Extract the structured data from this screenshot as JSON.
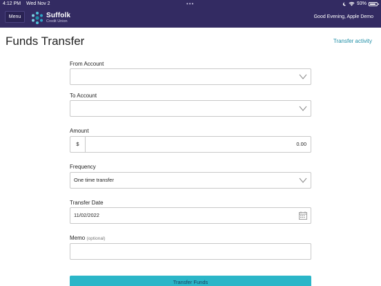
{
  "status_bar": {
    "time": "4:12 PM",
    "date": "Wed Nov 2",
    "dots": "•••",
    "battery_percent": "93%",
    "battery_level": 0.93
  },
  "header": {
    "menu_label": "Menu",
    "brand_name": "Suffolk",
    "brand_sub": "Credit Union",
    "greeting": "Good Evening, Apple Demo"
  },
  "page": {
    "title": "Funds Transfer",
    "activity_link": "Transfer activity"
  },
  "form": {
    "from_account": {
      "label": "From Account",
      "value": ""
    },
    "to_account": {
      "label": "To Account",
      "value": ""
    },
    "amount": {
      "label": "Amount",
      "currency": "$",
      "value": "0.00"
    },
    "frequency": {
      "label": "Frequency",
      "value": "One time transfer"
    },
    "transfer_date": {
      "label": "Transfer Date",
      "value": "11/02/2022"
    },
    "memo": {
      "label": "Memo",
      "optional": "(optional)",
      "value": ""
    },
    "submit_label": "Transfer Funds"
  },
  "icons": {
    "dropdown": "chevron-down-icon",
    "calendar": "calendar-icon",
    "wifi": "wifi-icon",
    "battery": "battery-icon",
    "moon": "moon-icon"
  },
  "colors": {
    "header_bg": "#332b62",
    "accent": "#1f8ea6",
    "button": "#2bb6c8"
  }
}
